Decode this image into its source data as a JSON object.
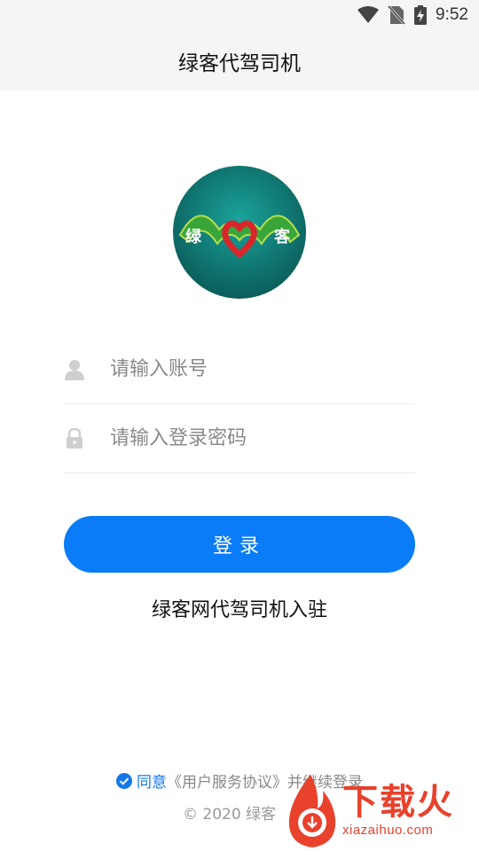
{
  "status_bar": {
    "time": "9:52"
  },
  "header": {
    "title": "绿客代驾司机"
  },
  "logo": {
    "left_char": "绿",
    "right_char": "客"
  },
  "form": {
    "username_placeholder": "请输入账号",
    "username_value": "",
    "password_placeholder": "请输入登录密码",
    "password_value": ""
  },
  "login_button": {
    "label": "登录"
  },
  "register_link": {
    "label": "绿客网代驾司机入驻"
  },
  "agreement": {
    "agree": "同意",
    "doc": "《用户服务协议》",
    "rest": "并继续登录",
    "checked": true
  },
  "footer": {
    "copyright": "© 2020 绿客"
  },
  "watermark": {
    "brand": "下载火",
    "site": "xiazaihuo.com"
  },
  "colors": {
    "primary": "#0a7cf7",
    "logo_teal": "#0f6e6a",
    "logo_green": "#3aa63a",
    "logo_red": "#d8262b",
    "watermark": "#e8412c"
  }
}
